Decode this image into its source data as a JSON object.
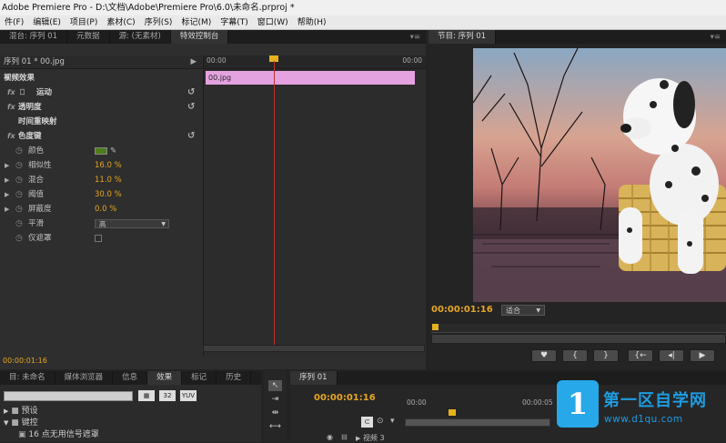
{
  "window": {
    "title": "Adobe Premiere Pro - D:\\文档\\Adobe\\Premiere Pro\\6.0\\未命名.prproj *"
  },
  "menu": [
    "件(F)",
    "编辑(E)",
    "项目(P)",
    "素材(C)",
    "序列(S)",
    "标记(M)",
    "字幕(T)",
    "窗口(W)",
    "帮助(H)"
  ],
  "top_left_tabs": [
    "混台: 序列 01",
    "元数据",
    "源: (无素材)",
    "特效控制台"
  ],
  "effect_controls": {
    "clip_header": "序列 01 * 00.jpg",
    "section_title": "视频效果",
    "effects": [
      {
        "fx": "fx",
        "name": "运动"
      },
      {
        "fx": "fx",
        "name": "透明度"
      },
      {
        "fx": "",
        "name": "时间重映射"
      },
      {
        "fx": "fx",
        "name": "色度键"
      }
    ],
    "params": [
      {
        "name": "颜色",
        "value": ""
      },
      {
        "name": "相似性",
        "value": "16.0 %"
      },
      {
        "name": "混合",
        "value": "11.0 %"
      },
      {
        "name": "阈值",
        "value": "30.0 %"
      },
      {
        "name": "屏蔽度",
        "value": "0.0 %"
      },
      {
        "name": "平滑",
        "value": "高"
      },
      {
        "name": "仅遮罩",
        "value": ""
      }
    ],
    "ruler_left": "00:00",
    "ruler_right": "00:00",
    "clip_name": "00.jpg",
    "current_time": "00:00:01:16",
    "key_color": "#4f7d1c"
  },
  "program_monitor": {
    "tab": "节目: 序列 01",
    "timecode": "00:00:01:16",
    "fit": "适合",
    "buttons": [
      "♥",
      "{",
      "}",
      "{←",
      "◂|",
      "▶"
    ]
  },
  "project_tabs": [
    "目: 未命名",
    "媒体浏览器",
    "信息",
    "效果",
    "标记",
    "历史"
  ],
  "project_items": [
    "预设",
    "键控",
    "16 点无用信号遮罩"
  ],
  "sequence": {
    "tab": "序列 01",
    "timecode": "00:00:01:16",
    "ruler_left": "00:00",
    "ruler_right": "00:00:05",
    "track": "视频 3"
  },
  "watermark": {
    "logo": "1",
    "name": "第一区自学网",
    "url": "www.d1qu.com"
  }
}
